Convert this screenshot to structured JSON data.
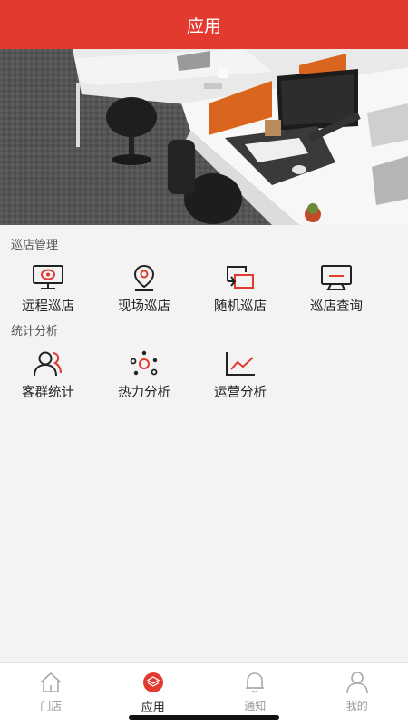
{
  "header": {
    "title": "应用"
  },
  "sections": [
    {
      "title": "巡店管理",
      "items": [
        {
          "label": "远程巡店",
          "icon": "monitor-eye-icon"
        },
        {
          "label": "现场巡店",
          "icon": "location-pin-icon"
        },
        {
          "label": "随机巡店",
          "icon": "shuffle-screen-icon"
        },
        {
          "label": "巡店查询",
          "icon": "monitor-query-icon"
        }
      ]
    },
    {
      "title": "统计分析",
      "items": [
        {
          "label": "客群统计",
          "icon": "customer-group-icon"
        },
        {
          "label": "热力分析",
          "icon": "heatmap-dots-icon"
        },
        {
          "label": "运营分析",
          "icon": "line-chart-icon"
        }
      ]
    }
  ],
  "tabbar": {
    "items": [
      {
        "label": "门店",
        "icon": "home-icon",
        "active": false
      },
      {
        "label": "应用",
        "icon": "apps-layers-icon",
        "active": true
      },
      {
        "label": "通知",
        "icon": "bell-icon",
        "active": false
      },
      {
        "label": "我的",
        "icon": "user-icon",
        "active": false
      }
    ]
  },
  "colors": {
    "accent": "#e23a2e",
    "text": "#222222",
    "muted": "#999999"
  }
}
